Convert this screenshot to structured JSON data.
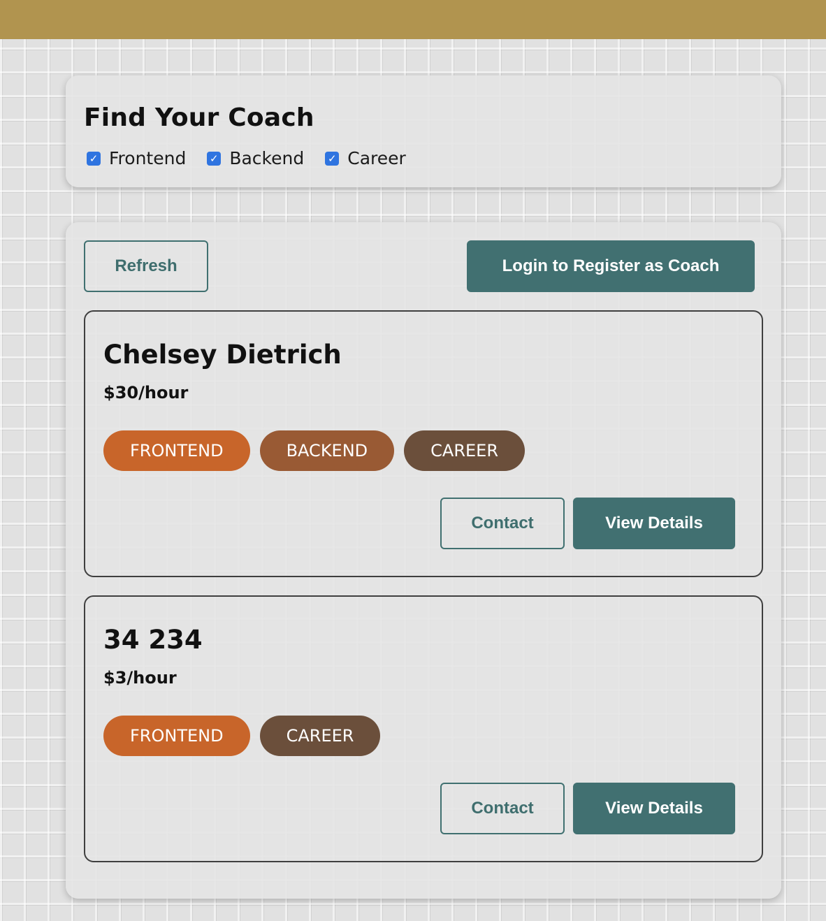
{
  "header": {
    "color": "#b1944f"
  },
  "filter": {
    "title": "Find Your Coach",
    "options": [
      {
        "label": "Frontend",
        "checked": true
      },
      {
        "label": "Backend",
        "checked": true
      },
      {
        "label": "Career",
        "checked": true
      }
    ]
  },
  "actions": {
    "refresh_label": "Refresh",
    "register_label": "Login to Register as Coach"
  },
  "coaches": [
    {
      "name": "Chelsey Dietrich",
      "rate": "$30/hour",
      "areas": [
        {
          "label": "FRONTEND",
          "color": "#c8652a"
        },
        {
          "label": "BACKEND",
          "color": "#995a34"
        },
        {
          "label": "CAREER",
          "color": "#6b4f3b"
        }
      ],
      "contact_label": "Contact",
      "details_label": "View Details"
    },
    {
      "name": "34 234",
      "rate": "$3/hour",
      "areas": [
        {
          "label": "FRONTEND",
          "color": "#c8652a"
        },
        {
          "label": "CAREER",
          "color": "#6b4f3b"
        }
      ],
      "contact_label": "Contact",
      "details_label": "View Details"
    }
  ],
  "colors": {
    "accent": "#417071",
    "checkbox": "#2f74e0"
  }
}
